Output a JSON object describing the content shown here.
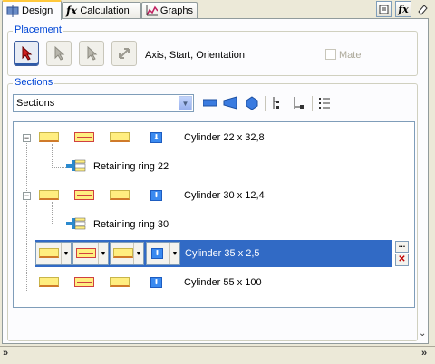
{
  "tabs": [
    {
      "label": "Design",
      "icon": "design-icon",
      "active": true
    },
    {
      "label": "Calculation",
      "icon": "fx-icon",
      "active": false
    },
    {
      "label": "Graphs",
      "icon": "graph-icon",
      "active": false
    }
  ],
  "placement": {
    "title": "Placement",
    "label": "Axis, Start, Orientation",
    "mate_label": "Mate",
    "mate_checked": false
  },
  "sections": {
    "title": "Sections",
    "dropdown_value": "Sections"
  },
  "tree": [
    {
      "label": "Cylinder 22 x 32,8",
      "kind": "section",
      "expander": "−"
    },
    {
      "label": "Retaining ring 22",
      "kind": "feature"
    },
    {
      "label": "Cylinder 30 x 12,4",
      "kind": "section",
      "expander": "−"
    },
    {
      "label": "Retaining ring 30",
      "kind": "feature"
    },
    {
      "label": "Cylinder 35 x 2,5",
      "kind": "section",
      "selected": true
    },
    {
      "label": "Cylinder 55 x 100",
      "kind": "section"
    }
  ],
  "selected_row": {
    "more_label": "...",
    "delete_label": "✕"
  },
  "colors": {
    "selection": "#316AC5",
    "group_title": "#0046D5",
    "panel_bg": "#FCFCFE"
  }
}
